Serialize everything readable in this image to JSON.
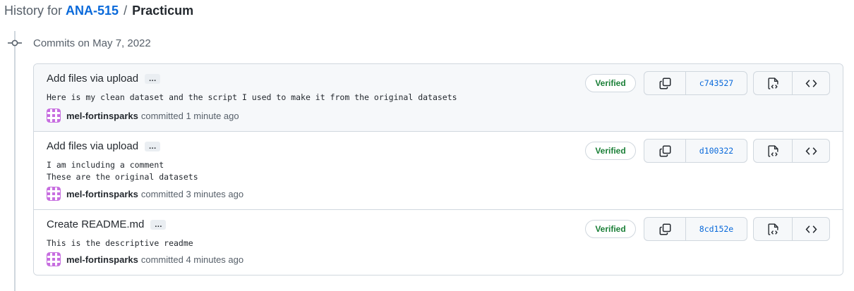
{
  "header": {
    "prefix": "History for",
    "repo": "ANA-515",
    "separator": "/",
    "path": "Practicum"
  },
  "timeline": {
    "date_label": "Commits on May 7, 2022",
    "icon": "git-commit-icon"
  },
  "commits": [
    {
      "title": "Add files via upload",
      "ellipsis": "…",
      "message": "Here is my clean dataset and the script I used to make it from the original datasets",
      "author": "mel-fortinsparks",
      "committed_text": "committed 1 minute ago",
      "verified_label": "Verified",
      "sha": "c743527"
    },
    {
      "title": "Add files via upload",
      "ellipsis": "…",
      "message": "I am including a comment\nThese are the original datasets",
      "author": "mel-fortinsparks",
      "committed_text": "committed 3 minutes ago",
      "verified_label": "Verified",
      "sha": "d100322"
    },
    {
      "title": "Create README.md",
      "ellipsis": "…",
      "message": "This is the descriptive readme",
      "author": "mel-fortinsparks",
      "committed_text": "committed 4 minutes ago",
      "verified_label": "Verified",
      "sha": "8cd152e"
    }
  ],
  "icons": {
    "copy": "copy-icon",
    "browse": "file-code-icon",
    "code": "code-icon",
    "avatar": "identicon-avatar"
  },
  "colors": {
    "link": "#0969da",
    "verified": "#1a7f37",
    "avatar": "#c76ee0",
    "border": "#d0d7de"
  }
}
